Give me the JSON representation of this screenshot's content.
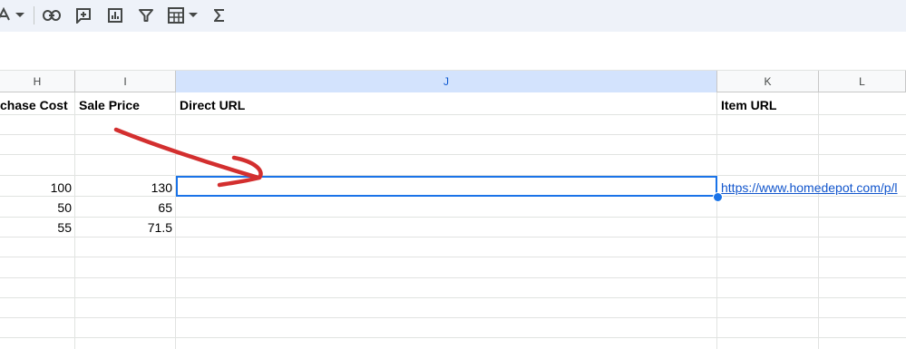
{
  "toolbar": {
    "icons": [
      "text-color-icon",
      "dropdown-caret-icon",
      "link-icon",
      "insert-comment-icon",
      "insert-chart-icon",
      "filter-icon",
      "table-view-icon",
      "dropdown-caret-icon",
      "functions-sigma-icon"
    ]
  },
  "columns": [
    {
      "letter": "H"
    },
    {
      "letter": "I"
    },
    {
      "letter": "J"
    },
    {
      "letter": "K"
    },
    {
      "letter": "L"
    }
  ],
  "header_row": {
    "h": "chase Cost",
    "i": "Sale Price",
    "j": "Direct URL",
    "k": "Item URL"
  },
  "rows": [
    {
      "h": "100",
      "i": "130",
      "k": "https://www.homedepot.com/p/l"
    },
    {
      "h": "50",
      "i": "65"
    },
    {
      "h": "55",
      "i": "71.5"
    }
  ],
  "selection": {
    "cell": "J",
    "accent": "#1a73e8"
  },
  "annotation": {
    "color": "#d32f2f"
  },
  "colors": {
    "toolbar_bg": "#eef2f9",
    "selected_header_bg": "#d3e3fd",
    "link": "#1155cc"
  }
}
